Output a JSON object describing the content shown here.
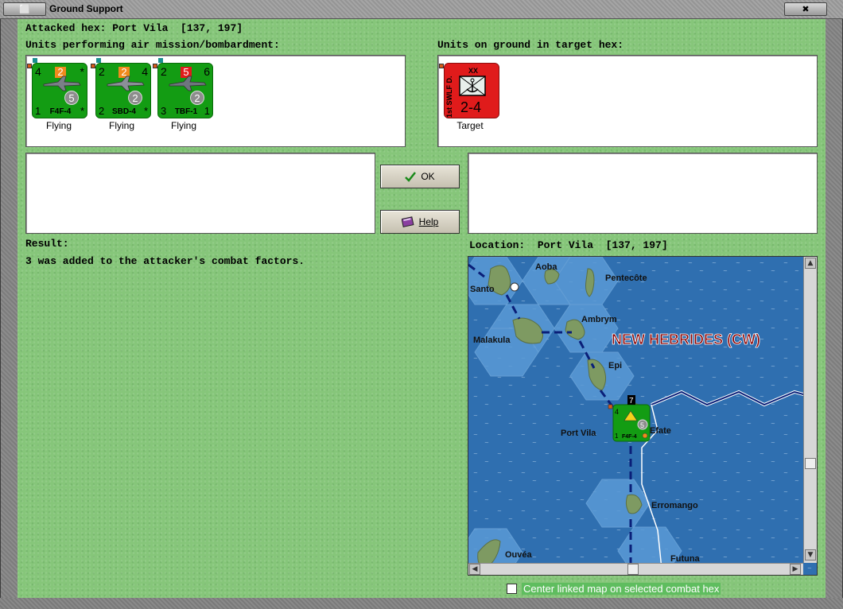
{
  "window": {
    "title": "Ground Support",
    "close_glyph": "✖",
    "sysmenu_glyph": "⬜"
  },
  "header": {
    "attacked_hex": "Attacked hex: Port Vila  [137, 197]",
    "air_units_label": "Units performing air mission/bombardment:",
    "ground_units_label": "Units on ground in target hex:"
  },
  "air_units": [
    {
      "top_left": "4",
      "top_num": "2",
      "top_num_color": "#f08a1c",
      "top_right": "*",
      "circle": "5",
      "bottom_left": "1",
      "code": "F4F-4",
      "bottom_right": "*",
      "caption": "Flying"
    },
    {
      "top_left": "2",
      "top_num": "2",
      "top_num_color": "#f08a1c",
      "top_right": "4",
      "circle": "2",
      "bottom_left": "2",
      "code": "SBD-4",
      "bottom_right": "*",
      "caption": "Flying"
    },
    {
      "top_left": "2",
      "top_num": "5",
      "top_num_color": "#e01b1b",
      "top_right": "6",
      "circle": "2",
      "bottom_left": "3",
      "code": "TBF-1",
      "bottom_right": "1",
      "caption": "Flying"
    }
  ],
  "ground_units": [
    {
      "side_text": "1st SWLF D.",
      "size": "XX",
      "strength": "2-4",
      "caption": "Target",
      "color": "#e01b1b"
    }
  ],
  "buttons": {
    "ok_label": "OK",
    "help_label": "Help"
  },
  "result": {
    "label": "Result:",
    "text": "3 was added to the attacker's combat factors."
  },
  "location": {
    "label": "Location:  Port Vila  [137, 197]"
  },
  "map": {
    "title": "NEW HEBRIDES (CW)",
    "places": [
      "Aoba",
      "Santo",
      "Pentecôte",
      "Ambrym",
      "Malakula",
      "Epi",
      "Port Vila",
      "Efate",
      "Erromango",
      "Ouvéa",
      "Futuna"
    ],
    "unit_counter": {
      "top_left": "4",
      "badge": "7",
      "circle": "5",
      "bottom_left": "1",
      "code": "F4F-4"
    }
  },
  "options": {
    "center_linked_map": "Center linked map on selected combat hex",
    "center_linked_map_checked": false
  },
  "colors": {
    "background_green": "#86c67a",
    "counter_green": "#139c13",
    "target_red": "#e01b1b",
    "sea_blue": "#2f6fb0",
    "map_title_red": "#8b0000"
  }
}
